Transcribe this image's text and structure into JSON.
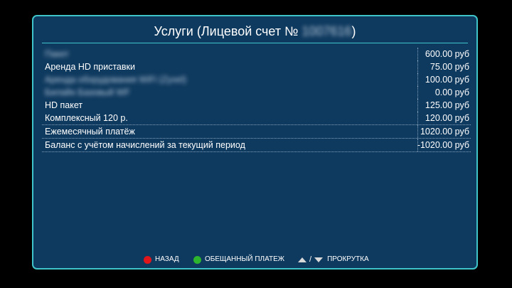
{
  "title": {
    "prefix": "Услуги (Лицевой счет №",
    "account": "1007616",
    "suffix": ")"
  },
  "rows": [
    {
      "label": "Пакет",
      "amount": "600.00 руб",
      "blurred": true
    },
    {
      "label": "Аренда HD приставки",
      "amount": "75.00 руб",
      "blurred": false
    },
    {
      "label": "Аренда оборудования WiFi (Zyxel)",
      "amount": "100.00 руб",
      "blurred": true
    },
    {
      "label": "Билайн Базовый WF",
      "amount": "0.00 руб",
      "blurred": true
    },
    {
      "label": "HD пакет",
      "amount": "125.00 руб",
      "blurred": false
    },
    {
      "label": "Комплексный 120 р.",
      "amount": "120.00 руб",
      "blurred": false
    }
  ],
  "monthly": {
    "label": "Ежемесячный платёж",
    "amount": "1020.00 руб"
  },
  "balance": {
    "label": "Баланс с учётом начислений за текущий период",
    "amount": "-1020.00 руб"
  },
  "footer": {
    "back": {
      "label": "НАЗАД",
      "color": "#e0161b"
    },
    "promised": {
      "label": "ОБЕЩАННЫЙ ПЛАТЕЖ",
      "color": "#2db52d"
    },
    "scroll": {
      "label": "ПРОКРУТКА",
      "separator": "/",
      "icons": [
        "arrow-up-icon",
        "arrow-down-icon"
      ]
    }
  },
  "colors": {
    "panel": "#0f3a5f",
    "border": "#3fc4c9",
    "background": "#000000"
  }
}
